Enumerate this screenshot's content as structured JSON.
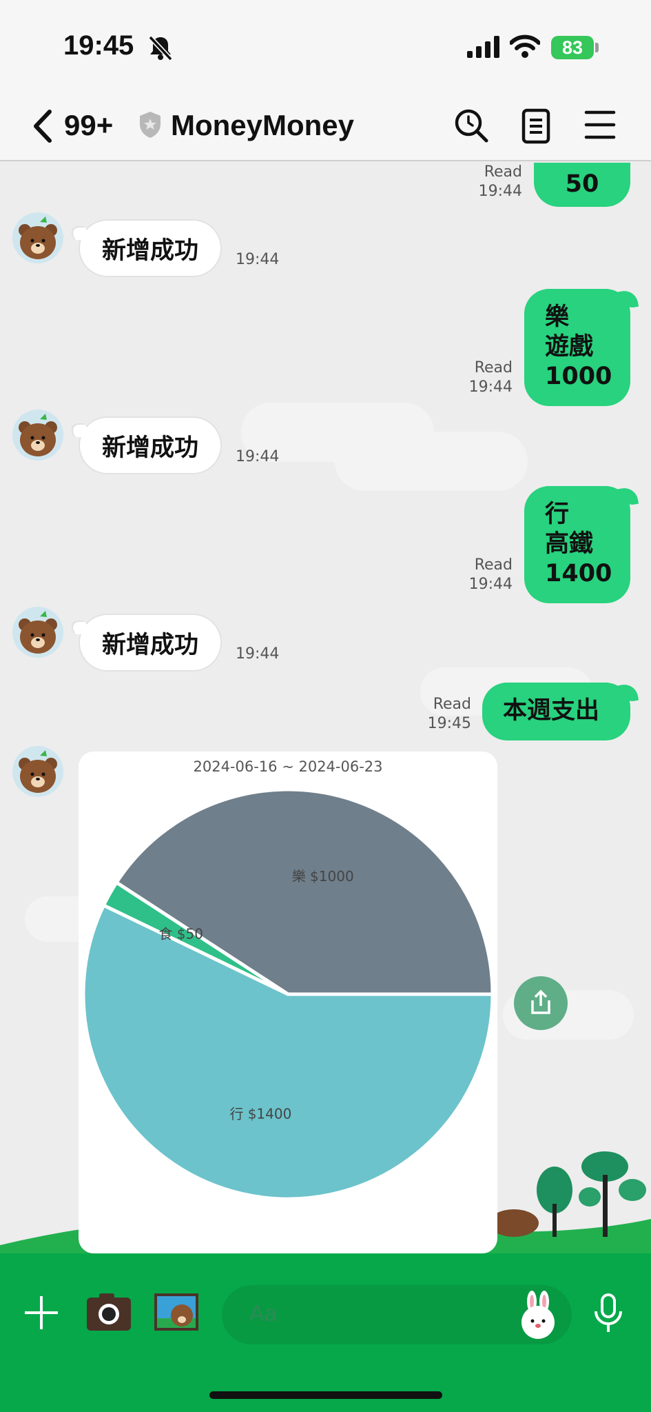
{
  "status_bar": {
    "time": "19:45",
    "battery": "83"
  },
  "header": {
    "unread_count": "99+",
    "chat_title": "MoneyMoney"
  },
  "messages": {
    "m1": {
      "text": "50",
      "read_label": "Read",
      "time": "19:44"
    },
    "r1": {
      "text": "新增成功",
      "time": "19:44"
    },
    "m2": {
      "line1": "樂",
      "line2": "遊戲",
      "line3": "1000",
      "read_label": "Read",
      "time": "19:44"
    },
    "r2": {
      "text": "新增成功",
      "time": "19:44"
    },
    "m3": {
      "line1": "行",
      "line2": "高鐵",
      "line3": "1400",
      "read_label": "Read",
      "time": "19:44"
    },
    "r3": {
      "text": "新增成功",
      "time": "19:44"
    },
    "m4": {
      "text": "本週支出",
      "read_label": "Read",
      "time": "19:45"
    }
  },
  "chart_data": {
    "type": "pie",
    "title": "2024-06-16 ~ 2024-06-23",
    "slices": [
      {
        "label": "樂 $1000",
        "value": 1000,
        "color": "#6f7f8b"
      },
      {
        "label": "食 $50",
        "value": 50,
        "color": "#2fc08a"
      },
      {
        "label": "行 $1400",
        "value": 1400,
        "color": "#6cc3cb"
      }
    ]
  },
  "composer": {
    "placeholder": "Aa"
  },
  "icons": {
    "status": [
      "bell-muted-icon",
      "signal-icon",
      "wifi-icon",
      "battery-icon"
    ],
    "header": [
      "back-chevron-icon",
      "shield-icon",
      "search-icon",
      "notes-icon",
      "menu-icon"
    ],
    "bottom": [
      "plus-icon",
      "camera-icon",
      "photo-icon",
      "sticker-icon",
      "mic-icon"
    ],
    "share": "share-icon"
  }
}
